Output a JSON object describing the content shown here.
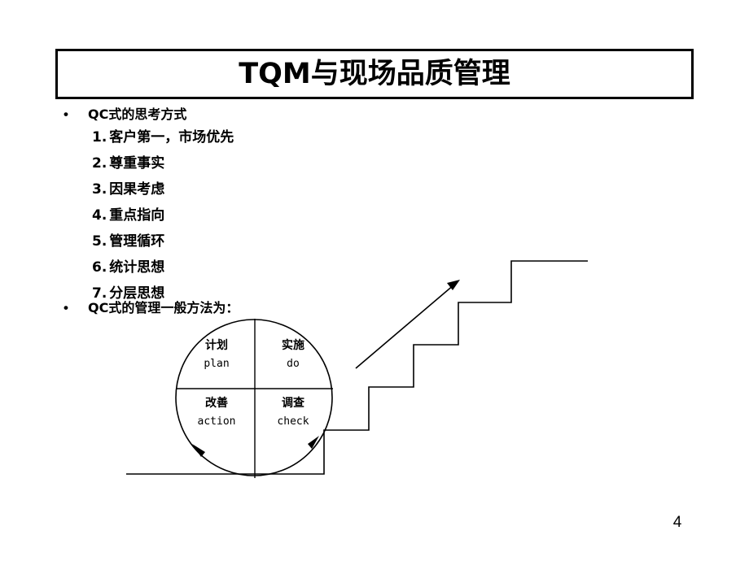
{
  "slide": {
    "title": "TQM与现场品质管理",
    "page_number": "4",
    "background_color": "#ffffff",
    "line_color": "#000000"
  },
  "content": {
    "bullets": [
      {
        "marker": "•",
        "label": "QC式的思考方式"
      },
      {
        "marker": "•",
        "label": "QC式的管理一般方法为："
      }
    ],
    "numbered_items": [
      {
        "index": "1.",
        "text": "客户第一，市场优先"
      },
      {
        "index": "2.",
        "text": "尊重事实"
      },
      {
        "index": "3.",
        "text": "因果考虑"
      },
      {
        "index": "4.",
        "text": "重点指向"
      },
      {
        "index": "5.",
        "text": "管理循环"
      },
      {
        "index": "6.",
        "text": "统计思想"
      },
      {
        "index": "7.",
        "text": "分层思想"
      }
    ]
  },
  "diagram": {
    "name": "pdca-staircase",
    "wheel": {
      "quadrants": [
        {
          "position": "top-left",
          "cn": "计划",
          "en": "plan"
        },
        {
          "position": "top-right",
          "cn": "实施",
          "en": "do"
        },
        {
          "position": "bottom-left",
          "cn": "改善",
          "en": "action"
        },
        {
          "position": "bottom-right",
          "cn": "调查",
          "en": "check"
        }
      ]
    },
    "staircase": {
      "steps": 5
    },
    "growth_arrow": {
      "direction": "up-right"
    }
  }
}
